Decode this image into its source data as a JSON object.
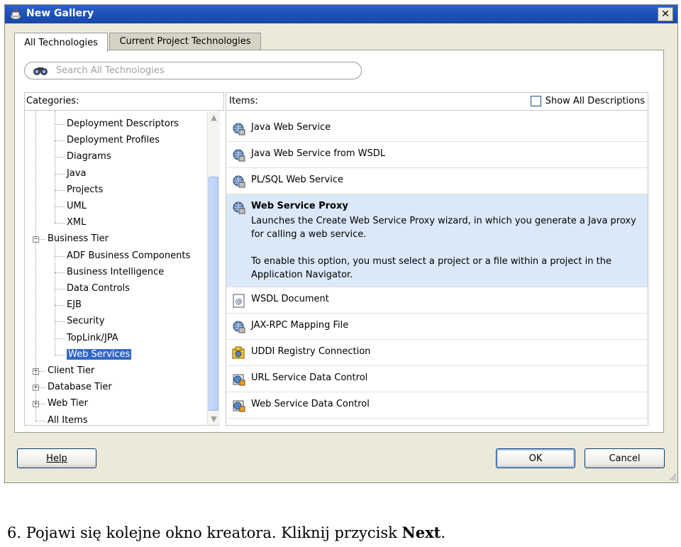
{
  "window": {
    "title": "New Gallery",
    "close_label": "✕"
  },
  "tabs": [
    {
      "label": "All Technologies",
      "active": true
    },
    {
      "label": "Current Project Technologies",
      "active": false
    }
  ],
  "search": {
    "placeholder": "Search All Technologies",
    "value": ""
  },
  "categories": {
    "header": "Categories:",
    "items": [
      {
        "label": "Deployment Descriptors",
        "level": 2
      },
      {
        "label": "Deployment Profiles",
        "level": 2
      },
      {
        "label": "Diagrams",
        "level": 2
      },
      {
        "label": "Java",
        "level": 2
      },
      {
        "label": "Projects",
        "level": 2
      },
      {
        "label": "UML",
        "level": 2
      },
      {
        "label": "XML",
        "level": 2
      },
      {
        "label": "Business Tier",
        "level": 1,
        "expander": "−"
      },
      {
        "label": "ADF Business Components",
        "level": 2
      },
      {
        "label": "Business Intelligence",
        "level": 2
      },
      {
        "label": "Data Controls",
        "level": 2
      },
      {
        "label": "EJB",
        "level": 2
      },
      {
        "label": "Security",
        "level": 2
      },
      {
        "label": "TopLink/JPA",
        "level": 2
      },
      {
        "label": "Web Services",
        "level": 2,
        "selected": true
      },
      {
        "label": "Client Tier",
        "level": 1,
        "expander": "+"
      },
      {
        "label": "Database Tier",
        "level": 1,
        "expander": "+"
      },
      {
        "label": "Web Tier",
        "level": 1,
        "expander": "+"
      },
      {
        "label": "All Items",
        "level": 1
      }
    ]
  },
  "items_panel": {
    "header": "Items:",
    "show_all_descriptions": "Show All Descriptions",
    "items": [
      {
        "label": "Java Web Service",
        "icon": "web-service-icon"
      },
      {
        "label": "Java Web Service from WSDL",
        "icon": "web-service-icon"
      },
      {
        "label": "PL/SQL Web Service",
        "icon": "web-service-icon"
      },
      {
        "label": "Web Service Proxy",
        "icon": "web-service-icon",
        "selected": true,
        "desc1": "Launches the Create Web Service Proxy wizard, in which you generate a Java proxy for calling a web service.",
        "desc2": "To enable this option, you must select a project or a file within a project in the Application Navigator."
      },
      {
        "label": "WSDL Document",
        "icon": "wsdl-document-icon"
      },
      {
        "label": "JAX-RPC Mapping File",
        "icon": "web-service-icon"
      },
      {
        "label": "UDDI Registry Connection",
        "icon": "uddi-connection-icon"
      },
      {
        "label": "URL Service Data Control",
        "icon": "data-control-icon"
      },
      {
        "label": "Web Service Data Control",
        "icon": "data-control-icon"
      }
    ]
  },
  "buttons": {
    "help": "Help",
    "ok": "OK",
    "cancel": "Cancel"
  },
  "caption": {
    "text": "6. Pojawi się kolejne okno kreatora. Kliknij przycisk ",
    "bold": "Next",
    "end": "."
  }
}
